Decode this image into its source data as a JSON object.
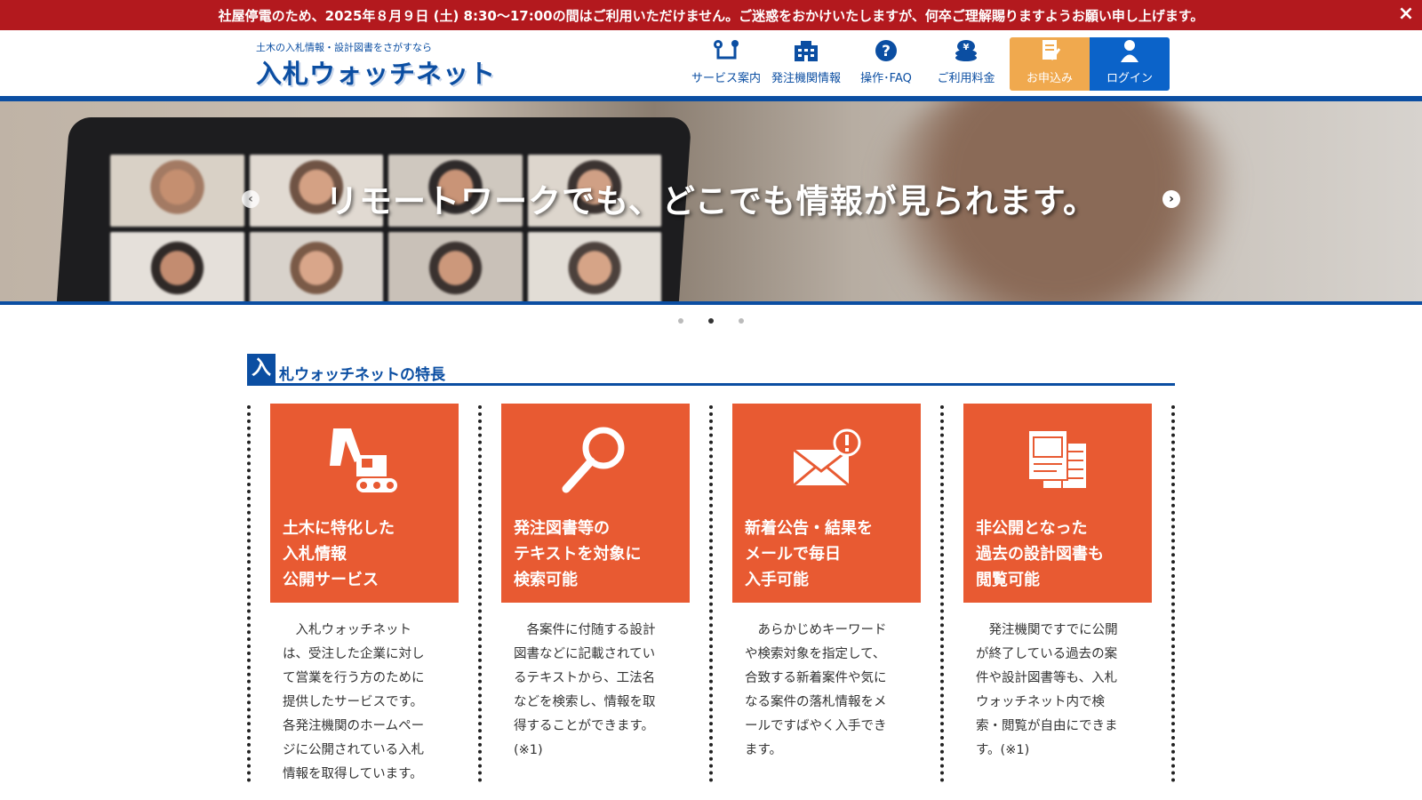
{
  "notice": {
    "text": "社屋停電のため、2025年８月９日 (土) 8:30〜17:00の間はご利用いただけません。ご迷惑をおかけいたしますが、何卒ご理解賜りますようお願い申し上げます。",
    "close": "×"
  },
  "header": {
    "tagline": "土木の入札情報・設計図書をさがすなら",
    "logo": "入札ウォッチネット",
    "nav": [
      {
        "label": "サービス案内",
        "icon": "service-map-icon"
      },
      {
        "label": "発注機関情報",
        "icon": "building-icon"
      },
      {
        "label": "操作･FAQ",
        "icon": "question-icon"
      },
      {
        "label": "ご利用料金",
        "icon": "yen-coins-icon"
      },
      {
        "label": "お申込み",
        "icon": "application-form-icon"
      },
      {
        "label": "ログイン",
        "icon": "user-icon"
      }
    ],
    "colors": {
      "primary": "#0b4ea2",
      "apply": "#f0a94e",
      "login": "#0b63c9"
    }
  },
  "hero": {
    "caption": "リモートワークでも、どこでも情報が見られます。",
    "prev": "‹",
    "next": "›",
    "slides": 3,
    "active_slide": 2
  },
  "features": {
    "mark": "入",
    "title": "札ウォッチネットの特長",
    "card_color": "#e85a32",
    "items": [
      {
        "icon": "excavator-icon",
        "title": [
          "土木に特化した",
          "入札情報",
          "公開サービス"
        ],
        "desc": [
          "　入札ウォッチネット",
          "は、受注した企業に対し",
          "て営業を行う方のために",
          "提供したサービスです。",
          "各発注機関のホームペー",
          "ジに公開されている入札",
          "情報を取得しています。"
        ]
      },
      {
        "icon": "magnifier-icon",
        "title": [
          "発注図書等の",
          "テキストを対象に",
          "検索可能"
        ],
        "desc": [
          "　各案件に付随する設計",
          "図書などに記載されてい",
          "るテキストから、工法名",
          "などを検索し、情報を取",
          "得することができます。",
          "(※1)"
        ]
      },
      {
        "icon": "mail-alert-icon",
        "title": [
          "新着公告・結果を",
          "メールで毎日",
          "入手可能"
        ],
        "desc": [
          "　あらかじめキーワード",
          "や検索対象を指定して、",
          "合致する新着案件や気に",
          "なる案件の落札情報をメ",
          "ールですばやく入手でき",
          "ます。"
        ]
      },
      {
        "icon": "documents-icon",
        "title": [
          "非公開となった",
          "過去の設計図書も",
          "閲覧可能"
        ],
        "desc": [
          "　発注機関ですでに公開",
          "が終了している過去の案",
          "件や設計図書等も、入札",
          "ウォッチネット内で検",
          "索・閲覧が自由にできま",
          "す。(※1)"
        ]
      }
    ]
  }
}
